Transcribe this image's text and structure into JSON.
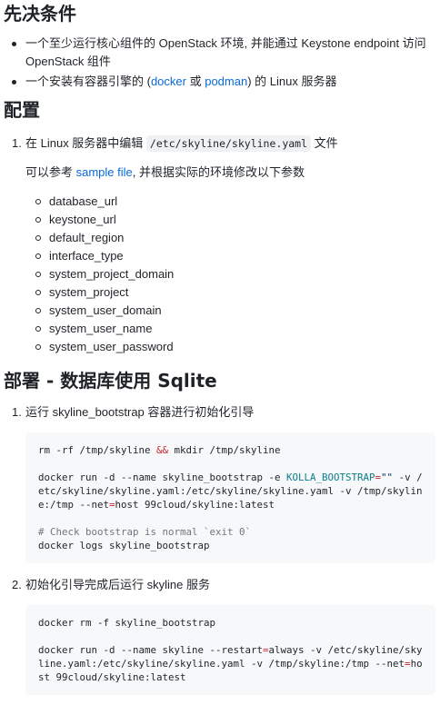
{
  "sections": {
    "prereq": {
      "title": "先决条件",
      "items": [
        {
          "pre": "一个至少运行核心组件的 OpenStack 环境, 并能通过 Keystone endpoint 访问 OpenStack 组件"
        },
        {
          "pre": "一个安装有容器引擎的 (",
          "link1": "docker",
          "mid": " 或 ",
          "link2": "podman",
          "post": ") 的 Linux 服务器"
        }
      ]
    },
    "config": {
      "title": "配置",
      "step1": {
        "number": "1.",
        "pre": "在 Linux 服务器中编辑 ",
        "code": "/etc/skyline/skyline.yaml",
        "post": " 文件"
      },
      "reference": {
        "pre": "可以参考 ",
        "link": "sample file",
        "post": ", 并根据实际的环境修改以下参数"
      },
      "params": [
        "database_url",
        "keystone_url",
        "default_region",
        "interface_type",
        "system_project_domain",
        "system_project",
        "system_user_domain",
        "system_user_name",
        "system_user_password"
      ]
    },
    "deploy": {
      "title": "部署 - 数据库使用 Sqlite",
      "step1": {
        "number": "1.",
        "text": "运行 skyline_bootstrap 容器进行初始化引导",
        "code": {
          "line1_a": "rm -rf /tmp/skyline ",
          "line1_op": "&&",
          "line1_b": " mkdir /tmp/skyline",
          "line2_a": "docker run -d --name skyline_bootstrap -e ",
          "line2_var": "KOLLA_BOOTSTRAP",
          "line2_eq": "=",
          "line2_str": "\"\"",
          "line2_b": " -v /etc/skyline/skyline.yaml:/etc/skyline/skyline.yaml -v /tmp/skyline:/tmp --",
          "line2_kw": "net",
          "line2_eq2": "=",
          "line2_c": "host 99cloud/skyline:latest",
          "comment": "# Check bootstrap is normal `exit 0`",
          "line3": "docker logs skyline_bootstrap"
        }
      },
      "step2": {
        "number": "2.",
        "text": "初始化引导完成后运行 skyline 服务",
        "code": {
          "line1": "docker rm -f skyline_bootstrap",
          "line2_a": "docker run -d --name skyline --",
          "line2_kw1": "restart",
          "line2_eq1": "=",
          "line2_b": "always -v /etc/skyline/skyline.yaml:/etc/skyline/skyline.yaml -v /tmp/skyline:/tmp --",
          "line2_kw2": "net",
          "line2_eq2": "=",
          "line2_c": "host 99cloud/skyline:latest"
        }
      }
    }
  }
}
